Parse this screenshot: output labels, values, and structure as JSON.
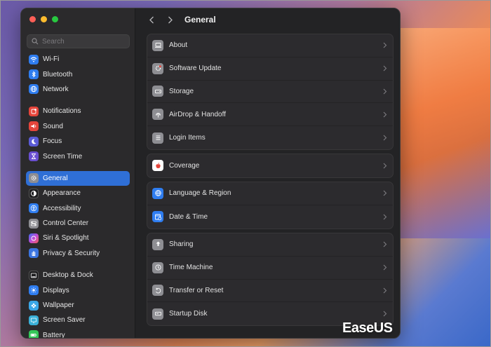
{
  "window": {
    "title": "General"
  },
  "search": {
    "placeholder": "Search"
  },
  "sidebar": {
    "items": [
      {
        "label": "Wi-Fi",
        "icon": "wifi-icon",
        "color": "#2f7df0"
      },
      {
        "label": "Bluetooth",
        "icon": "bluetooth-icon",
        "color": "#2f7df0"
      },
      {
        "label": "Network",
        "icon": "globe-icon",
        "color": "#2f7df0"
      },
      {
        "label": "Notifications",
        "icon": "bell-icon",
        "color": "#e5453b"
      },
      {
        "label": "Sound",
        "icon": "speaker-icon",
        "color": "#e5453b"
      },
      {
        "label": "Focus",
        "icon": "moon-icon",
        "color": "#5b5bd6"
      },
      {
        "label": "Screen Time",
        "icon": "hourglass-icon",
        "color": "#6a4fd1"
      },
      {
        "label": "General",
        "icon": "gear-icon",
        "color": "#8e8e93"
      },
      {
        "label": "Appearance",
        "icon": "appearance-icon",
        "color": "#1c1c1e"
      },
      {
        "label": "Accessibility",
        "icon": "accessibility-icon",
        "color": "#2f7df0"
      },
      {
        "label": "Control Center",
        "icon": "control-center-icon",
        "color": "#8e8e93"
      },
      {
        "label": "Siri & Spotlight",
        "icon": "siri-icon",
        "color": "#c04cd8"
      },
      {
        "label": "Privacy & Security",
        "icon": "hand-icon",
        "color": "#3a74e0"
      },
      {
        "label": "Desktop & Dock",
        "icon": "dock-icon",
        "color": "#1c1c1e"
      },
      {
        "label": "Displays",
        "icon": "sun-icon",
        "color": "#2f7df0"
      },
      {
        "label": "Wallpaper",
        "icon": "flower-icon",
        "color": "#3aa7e6"
      },
      {
        "label": "Screen Saver",
        "icon": "screensaver-icon",
        "color": "#3ab0d8"
      },
      {
        "label": "Battery",
        "icon": "battery-icon",
        "color": "#35c759"
      }
    ]
  },
  "groups": [
    {
      "rows": [
        {
          "label": "About",
          "icon": "laptop-icon",
          "color": "#8e8e93"
        },
        {
          "label": "Software Update",
          "icon": "gear-badge-icon",
          "color": "#8e8e93"
        },
        {
          "label": "Storage",
          "icon": "drive-icon",
          "color": "#8e8e93"
        },
        {
          "label": "AirDrop & Handoff",
          "icon": "airdrop-icon",
          "color": "#8e8e93"
        },
        {
          "label": "Login Items",
          "icon": "list-icon",
          "color": "#8e8e93"
        }
      ]
    },
    {
      "rows": [
        {
          "label": "Coverage",
          "icon": "apple-icon",
          "color": "#ffffff"
        }
      ]
    },
    {
      "rows": [
        {
          "label": "Language & Region",
          "icon": "globe-icon",
          "color": "#2f7df0"
        },
        {
          "label": "Date & Time",
          "icon": "calendar-clock-icon",
          "color": "#2f7df0"
        }
      ]
    },
    {
      "rows": [
        {
          "label": "Sharing",
          "icon": "sharing-icon",
          "color": "#8e8e93"
        },
        {
          "label": "Time Machine",
          "icon": "time-machine-icon",
          "color": "#8e8e93"
        },
        {
          "label": "Transfer or Reset",
          "icon": "reset-icon",
          "color": "#8e8e93"
        },
        {
          "label": "Startup Disk",
          "icon": "disk-icon",
          "color": "#8e8e93"
        }
      ]
    }
  ],
  "watermark": "EaseUS"
}
